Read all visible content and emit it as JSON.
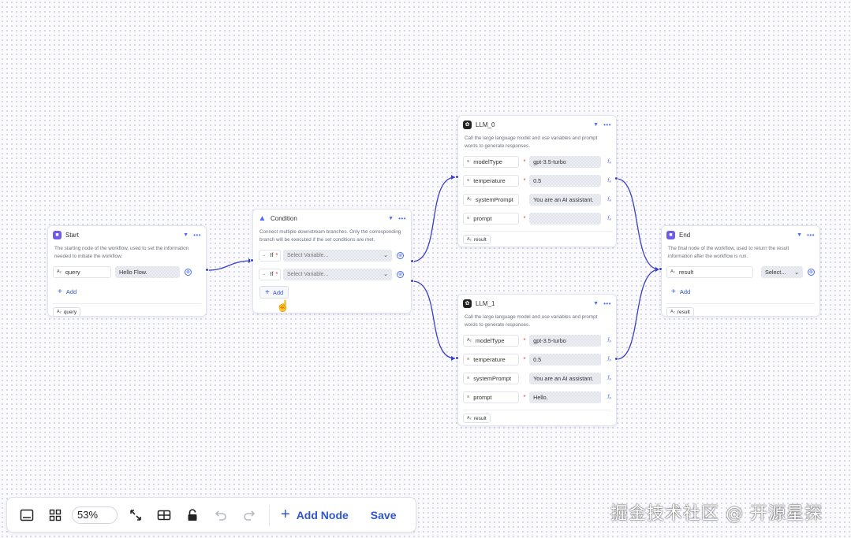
{
  "nodes": {
    "start": {
      "title": "Start",
      "desc": "The starting node of the workflow, used to set the information needed to initiate the workflow.",
      "param": {
        "type": "A₂",
        "name": "query",
        "value": "Hello Flow."
      },
      "add_label": "Add",
      "output": {
        "type": "A₂",
        "name": "query"
      }
    },
    "condition": {
      "title": "Condition",
      "desc": "Connect multiple downstream branches. Only the corresponding branch will be executed if the set conditions are met.",
      "branches": [
        {
          "label": "If",
          "placeholder": "Select Variable..."
        },
        {
          "label": "If",
          "placeholder": "Select Variable..."
        }
      ],
      "add_label": "Add"
    },
    "llm0": {
      "title": "LLM_0",
      "desc": "Call the large language model and use variables and prompt words to generate responses.",
      "params": [
        {
          "type": "≡",
          "name": "modelType",
          "value": "gpt-3.5-turbo"
        },
        {
          "type": "≡",
          "name": "temperature",
          "value": "0.5"
        },
        {
          "type": "A₂",
          "name": "systemPrompt",
          "value": "You are an AI assistant."
        },
        {
          "type": "≡",
          "name": "prompt",
          "value": ""
        }
      ],
      "output": {
        "type": "A₂",
        "name": "result"
      }
    },
    "llm1": {
      "title": "LLM_1",
      "desc": "Call the large language model and use variables and prompt words to generate responses.",
      "params": [
        {
          "type": "A₂",
          "name": "modelType",
          "value": "gpt-3.5-turbo"
        },
        {
          "type": "≡",
          "name": "temperature",
          "value": "0.5"
        },
        {
          "type": "≡",
          "name": "systemPrompt",
          "value": "You are an AI assistant."
        },
        {
          "type": "≡",
          "name": "prompt",
          "value": "Hello."
        }
      ],
      "output": {
        "type": "A₂",
        "name": "result"
      }
    },
    "end": {
      "title": "End",
      "desc": "The final node of the workflow, used to return the result information after the workflow is run.",
      "param": {
        "type": "A₂",
        "name": "result",
        "value": "Select..."
      },
      "add_label": "Add",
      "output": {
        "type": "A₂",
        "name": "result"
      }
    }
  },
  "toolbar": {
    "zoom": "53%",
    "add_node_label": "Add Node",
    "save_label": "Save",
    "icons": [
      "minimap-icon",
      "grid-icon",
      "fit-view-icon",
      "layout-icon",
      "lock-icon",
      "undo-icon",
      "redo-icon"
    ]
  },
  "watermark": "掘金技术社区 @ 开源星探",
  "colors": {
    "accent": "#2f55d4",
    "edge": "#3b3fc7",
    "node_icon": "#6f5ce6"
  }
}
